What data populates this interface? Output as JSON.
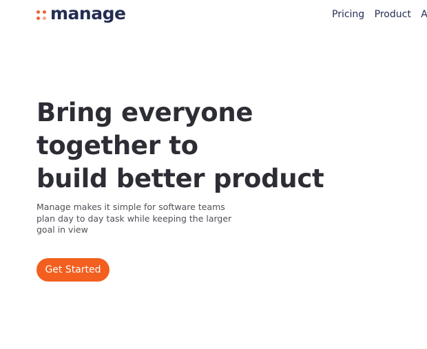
{
  "brand": {
    "name": "manage",
    "accent_color": "#f25f3a",
    "text_color": "#242d52"
  },
  "nav": {
    "items": [
      {
        "label": "Pricing"
      },
      {
        "label": "Product"
      },
      {
        "label": "Ab"
      }
    ]
  },
  "hero": {
    "headline_lines": [
      "Bring everyone",
      "together to",
      "build better product"
    ],
    "subtext": "Manage makes it simple for software teams plan day to day task while keeping the larger goal in view",
    "cta_label": "Get Started",
    "cta_color": "#f25f1f"
  }
}
